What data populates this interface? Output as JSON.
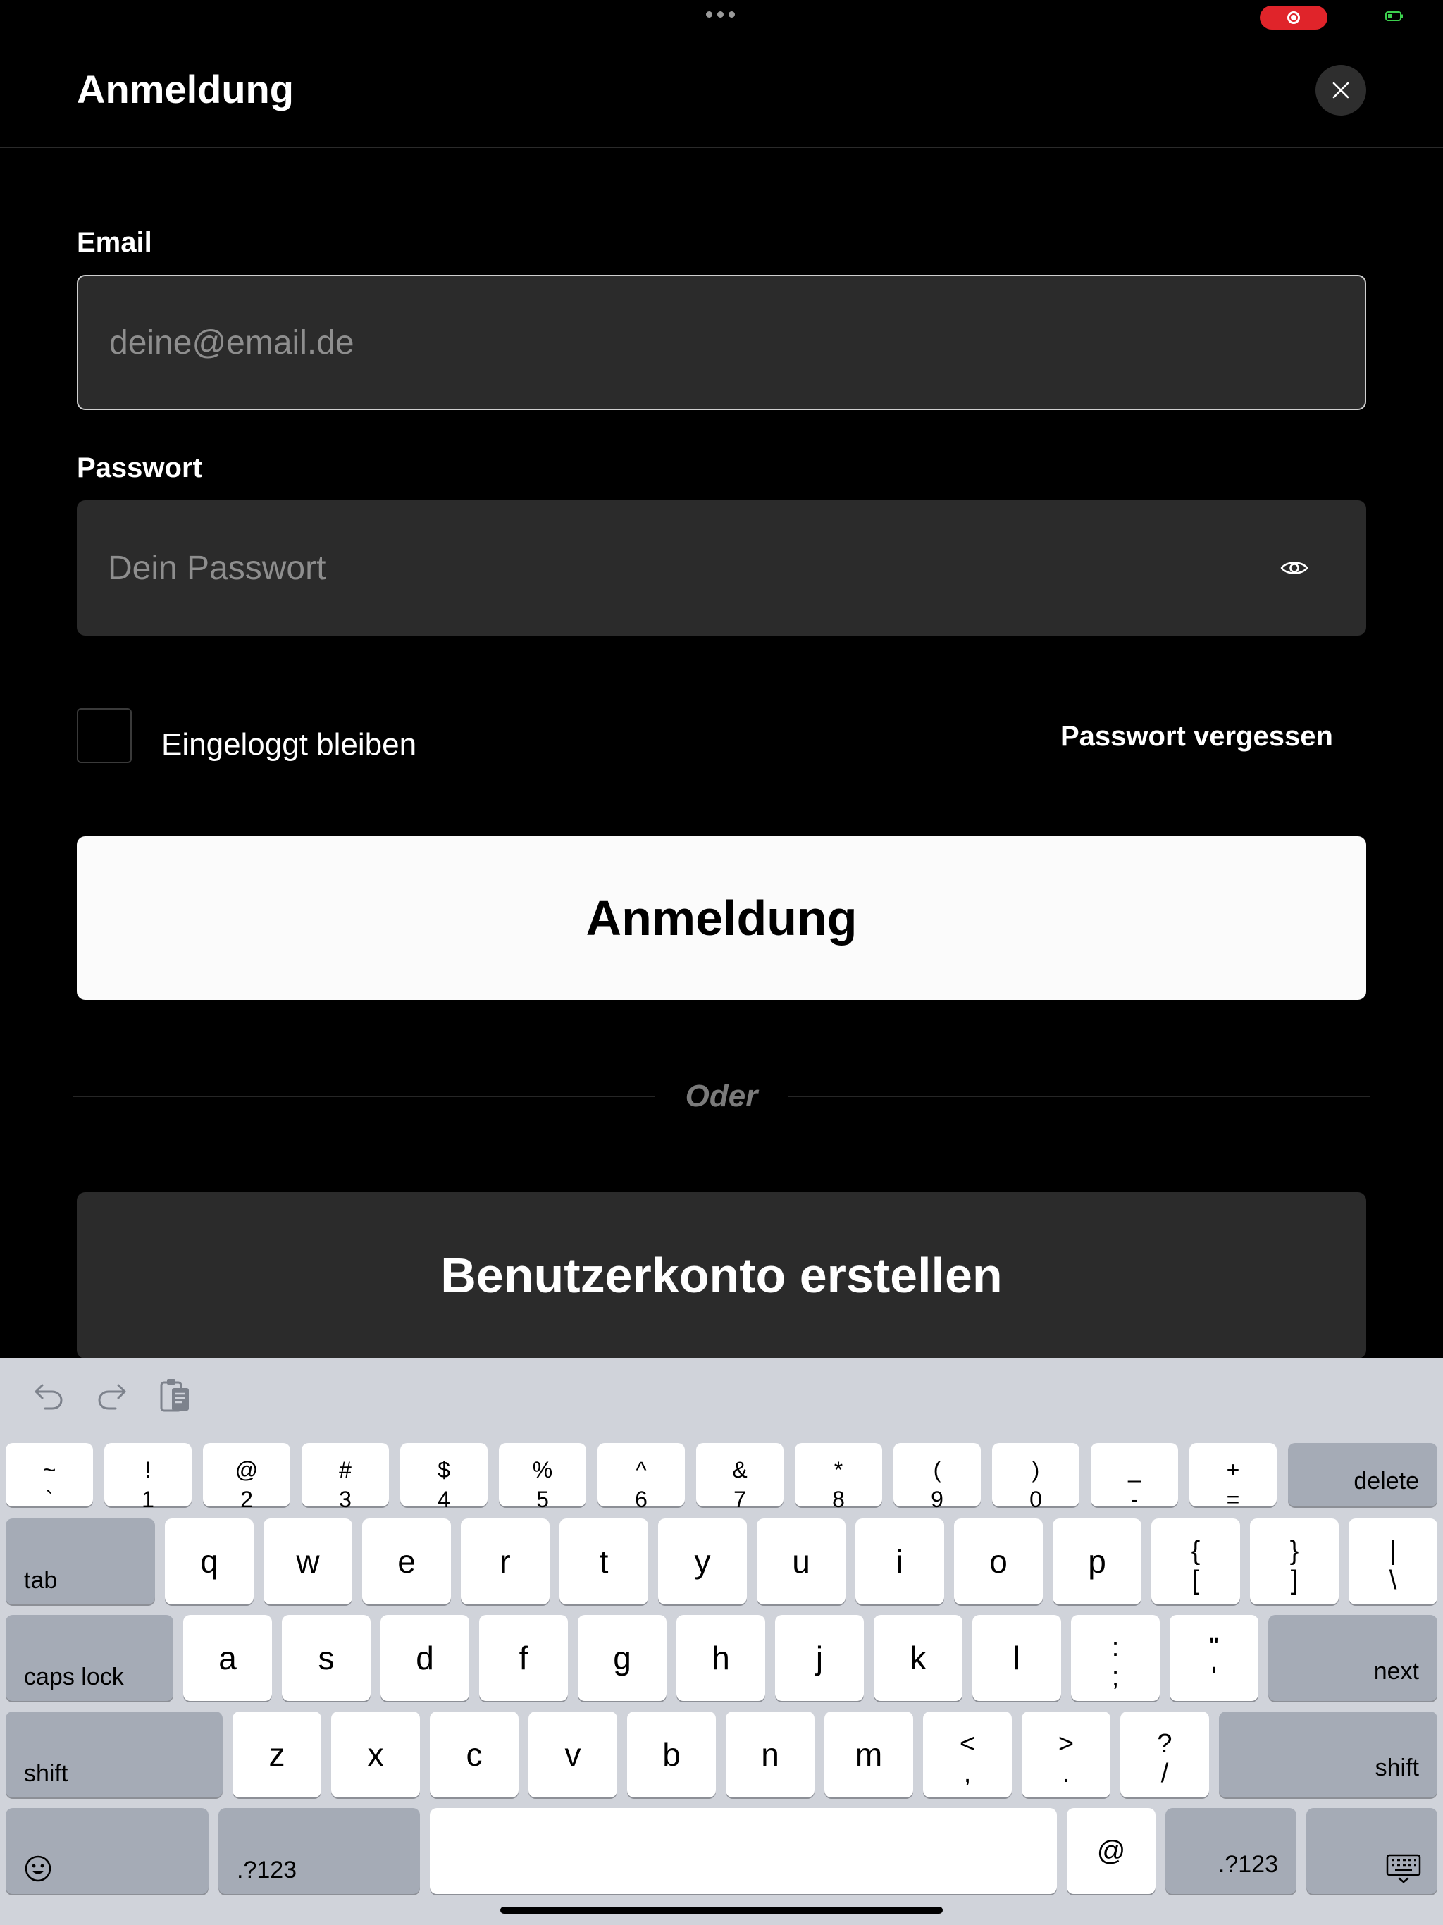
{
  "header": {
    "title": "Anmeldung",
    "close_icon": "close-icon"
  },
  "form": {
    "email_label": "Email",
    "email_placeholder": "deine@email.de",
    "email_value": "",
    "password_label": "Passwort",
    "password_placeholder": "Dein Passwort",
    "password_value": "",
    "remember_label": "Eingeloggt bleiben",
    "remember_checked": false,
    "forgot_label": "Passwort vergessen",
    "login_button": "Anmeldung",
    "divider_text": "Oder",
    "register_button": "Benutzerkonto erstellen"
  },
  "colors": {
    "background": "#000000",
    "field_background": "#2b2b2b",
    "primary_button": "#fbfbfb",
    "secondary_button": "#2b2b2b",
    "record_indicator": "#e0242a",
    "keyboard_background": "#d0d3da"
  },
  "keyboard": {
    "toolbar_icons": [
      "undo-icon",
      "redo-icon",
      "paste-icon"
    ],
    "number_row": [
      {
        "top": "~",
        "bottom": "`"
      },
      {
        "top": "!",
        "bottom": "1"
      },
      {
        "top": "@",
        "bottom": "2"
      },
      {
        "top": "#",
        "bottom": "3"
      },
      {
        "top": "$",
        "bottom": "4"
      },
      {
        "top": "%",
        "bottom": "5"
      },
      {
        "top": "^",
        "bottom": "6"
      },
      {
        "top": "&",
        "bottom": "7"
      },
      {
        "top": "*",
        "bottom": "8"
      },
      {
        "top": "(",
        "bottom": "9"
      },
      {
        "top": ")",
        "bottom": "0"
      },
      {
        "top": "_",
        "bottom": "-"
      },
      {
        "top": "+",
        "bottom": "="
      }
    ],
    "delete": "delete",
    "tab": "tab",
    "row_q": [
      "q",
      "w",
      "e",
      "r",
      "t",
      "y",
      "u",
      "i",
      "o",
      "p"
    ],
    "row_q_symbols": [
      {
        "top": "{",
        "bottom": "["
      },
      {
        "top": "}",
        "bottom": "]"
      },
      {
        "top": "|",
        "bottom": "\\"
      }
    ],
    "caps_lock": "caps lock",
    "row_a": [
      "a",
      "s",
      "d",
      "f",
      "g",
      "h",
      "j",
      "k",
      "l"
    ],
    "row_a_symbols": [
      {
        "top": ":",
        "bottom": ";"
      },
      {
        "top": "\"",
        "bottom": "'"
      }
    ],
    "next": "next",
    "shift_left": "shift",
    "row_z": [
      "z",
      "x",
      "c",
      "v",
      "b",
      "n",
      "m"
    ],
    "row_z_symbols": [
      {
        "top": "<",
        "bottom": ","
      },
      {
        "top": ">",
        "bottom": "."
      },
      {
        "top": "?",
        "bottom": "/"
      }
    ],
    "shift_right": "shift",
    "emoji_icon": "emoji-icon",
    "numbers_left": ".?123",
    "space": "",
    "at": "@",
    "numbers_right": ".?123",
    "hide_keyboard_icon": "keyboard-dismiss-icon"
  }
}
